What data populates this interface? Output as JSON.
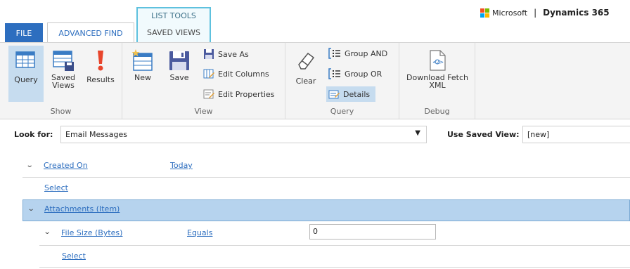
{
  "brand": {
    "ms_label": "Microsoft",
    "separator": "|",
    "product": "Dynamics 365",
    "ms_colors": [
      "#f25022",
      "#7fba00",
      "#00a4ef",
      "#ffb900"
    ]
  },
  "tabs": {
    "contextual_group": "LIST TOOLS",
    "file": "FILE",
    "advanced_find": "ADVANCED FIND",
    "saved_views": "SAVED VIEWS"
  },
  "ribbon": {
    "show": {
      "label": "Show",
      "query": "Query",
      "saved_views": "Saved Views",
      "results": "Results"
    },
    "view": {
      "label": "View",
      "new": "New",
      "save": "Save",
      "save_as": "Save As",
      "edit_columns": "Edit Columns",
      "edit_properties": "Edit Properties"
    },
    "query": {
      "label": "Query",
      "clear": "Clear",
      "group_and": "Group AND",
      "group_or": "Group OR",
      "details": "Details"
    },
    "debug": {
      "label": "Debug",
      "download_fetch_xml": "Download Fetch XML"
    }
  },
  "lookbar": {
    "look_for_label": "Look for:",
    "look_for_value": "Email Messages",
    "dropdown_arrow": "▼",
    "use_saved_view_label": "Use Saved View:",
    "saved_view_value": "[new]"
  },
  "query_rows": {
    "created_on": {
      "field": "Created On",
      "operator": "Today"
    },
    "select_1": "Select",
    "attachments": "Attachments (Item)",
    "file_size": {
      "field": "File Size (Bytes)",
      "operator": "Equals",
      "value": "0"
    },
    "select_2": "Select"
  },
  "colors": {
    "accent": "#2d6ebf",
    "contextual_border": "#5ec1de",
    "selected_row": "#b6d3ee"
  }
}
